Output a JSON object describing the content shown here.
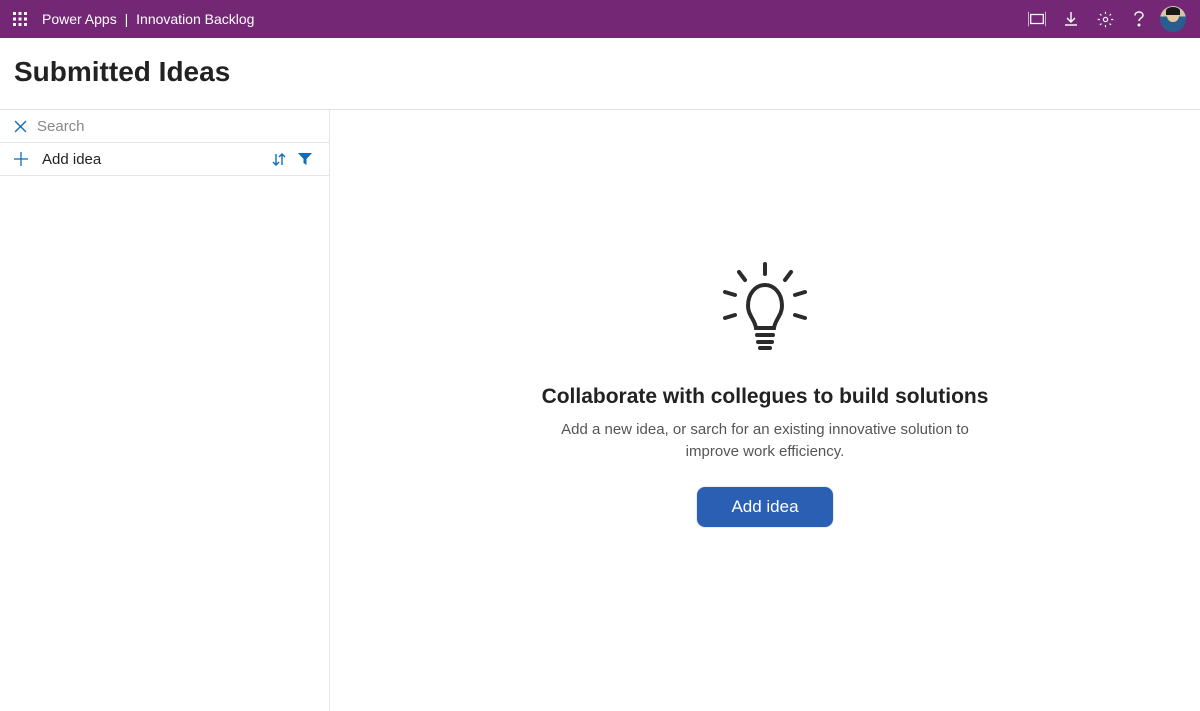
{
  "header": {
    "product": "Power Apps",
    "divider": "|",
    "app": "Innovation Backlog"
  },
  "page": {
    "title": "Submitted Ideas"
  },
  "sidebar": {
    "search_placeholder": "Search",
    "add_idea_label": "Add idea"
  },
  "empty_state": {
    "title": "Collaborate with collegues to build solutions",
    "subtitle": "Add a new idea, or sarch for an existing innovative solution to improve work efficiency.",
    "button_label": "Add idea"
  },
  "colors": {
    "brand": "#742774",
    "accent": "#0f6cbd",
    "primary_button": "#2a5fb4"
  }
}
